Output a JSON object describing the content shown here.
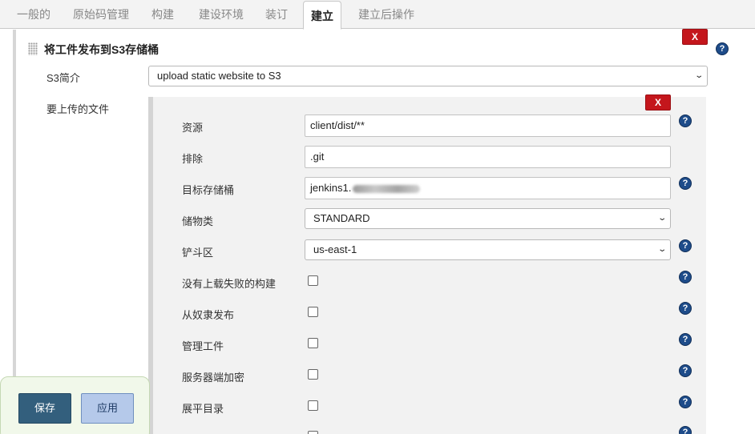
{
  "tabs": [
    "一般的",
    "原始码管理",
    "构建",
    "建设环境",
    "装订",
    "建立",
    "建立后操作"
  ],
  "active_tab": "建立",
  "section": {
    "title": "将工件发布到S3存储桶",
    "remove_label": "X",
    "profile_label": "S3简介",
    "profile_value": "upload static website to S3",
    "files_label": "要上传的文件"
  },
  "entry": {
    "remove_label": "X",
    "fields": {
      "source_label": "资源",
      "source_value": "client/dist/**",
      "exclude_label": "排除",
      "exclude_value": ".git",
      "bucket_label": "目标存储桶",
      "bucket_value": "jenkins1.",
      "storage_class_label": "储物类",
      "storage_class_value": "STANDARD",
      "region_label": "铲斗区",
      "region_value": "us-east-1"
    },
    "checkboxes": [
      {
        "label": "没有上载失败的构建",
        "checked": false
      },
      {
        "label": "从奴隶发布",
        "checked": false
      },
      {
        "label": "管理工件",
        "checked": false
      },
      {
        "label": "服务器端加密",
        "checked": false
      },
      {
        "label": "展平目录",
        "checked": false
      }
    ]
  },
  "help_glyph": "?",
  "icons": {
    "drag": "drag-handle-icon",
    "help": "help-icon",
    "dropdown": "chevron-down-icon"
  },
  "buttons": {
    "save": "保存",
    "apply": "应用"
  },
  "colors": {
    "remove": "#c4161c",
    "help": "#1e4c8a",
    "save": "#335f7d",
    "apply": "#b5c9ea"
  }
}
